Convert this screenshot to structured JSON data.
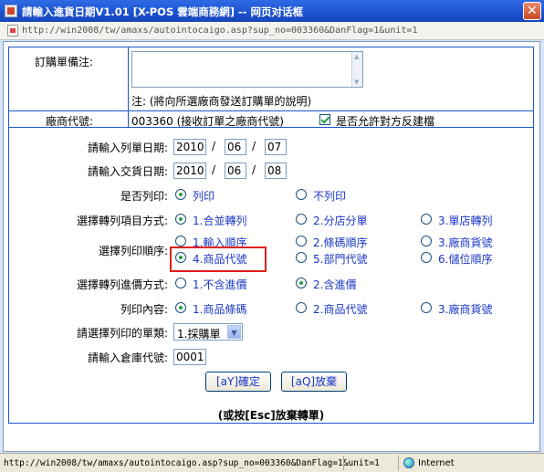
{
  "window": {
    "title": "請輸入進貨日期V1.01 [X-POS 雲端商務網] -- 网页对话框",
    "close_glyph": "✕",
    "address": "http://win2008/tw/amaxs/autointocaigo.asp?sup_no=003360&DanFlag=1&unit=1"
  },
  "form": {
    "note_label": "訂購單備注:",
    "note_value": "",
    "note_hint": "注: (將向所選廠商發送訂購單的說明)",
    "vendor_label": "廠商代號:",
    "vendor_value": "003360 (接收訂單之廠商代號)",
    "allow_label": "是否允許對方反建檔",
    "allow_checked": true,
    "order_date_label": "請輸入列單日期:",
    "order_date": {
      "year": "2010",
      "month": "06",
      "day": "07"
    },
    "delivery_date_label": "請輸入交貨日期:",
    "delivery_date": {
      "year": "2010",
      "month": "06",
      "day": "08"
    },
    "date_sep": "/",
    "print_label": "是否列印:",
    "print_options": [
      {
        "label": "列印",
        "checked": true
      },
      {
        "label": "不列印",
        "checked": false
      }
    ],
    "method_label": "選擇轉列項目方式:",
    "method_options": [
      {
        "label": "1.合並轉列",
        "checked": true
      },
      {
        "label": "2.分店分單",
        "checked": false
      },
      {
        "label": "3.單店轉列",
        "checked": false
      }
    ],
    "order_label": "選擇列印順序:",
    "order_options": [
      {
        "label": "1.輸入順序",
        "checked": false
      },
      {
        "label": "2.條碼順序",
        "checked": false
      },
      {
        "label": "3.廠商貨號",
        "checked": false
      },
      {
        "label": "4.商品代號",
        "checked": true
      },
      {
        "label": "5.部門代號",
        "checked": false
      },
      {
        "label": "6.儲位順序",
        "checked": false
      }
    ],
    "price_label": "選擇轉列進價方式:",
    "price_options": [
      {
        "label": "1.不含進價",
        "checked": false
      },
      {
        "label": "2.含進價",
        "checked": true
      }
    ],
    "content_label": "列印內容:",
    "content_options": [
      {
        "label": "1.商品條碼",
        "checked": true
      },
      {
        "label": "2.商品代號",
        "checked": false
      },
      {
        "label": "3.廠商貨號",
        "checked": false
      }
    ],
    "doctype_label": "請選擇列印的單類:",
    "doctype_value": "1.採購單",
    "warehouse_label": "請輸入倉庫代號:",
    "warehouse_value": "0001",
    "confirm_label": "[aY]確定",
    "cancel_label": "[aQ]放棄",
    "esc_hint": "(或按[Esc]放棄轉單)"
  },
  "status": {
    "url": "http://win2008/tw/amaxs/autointocaigo.asp?sup_no=003360&DanFlag=1&unit=1",
    "zone": "Internet"
  },
  "colors": {
    "highlight_box": "#e0201c",
    "frame_border": "#1e57c9",
    "option_text": "#1a37c8"
  }
}
